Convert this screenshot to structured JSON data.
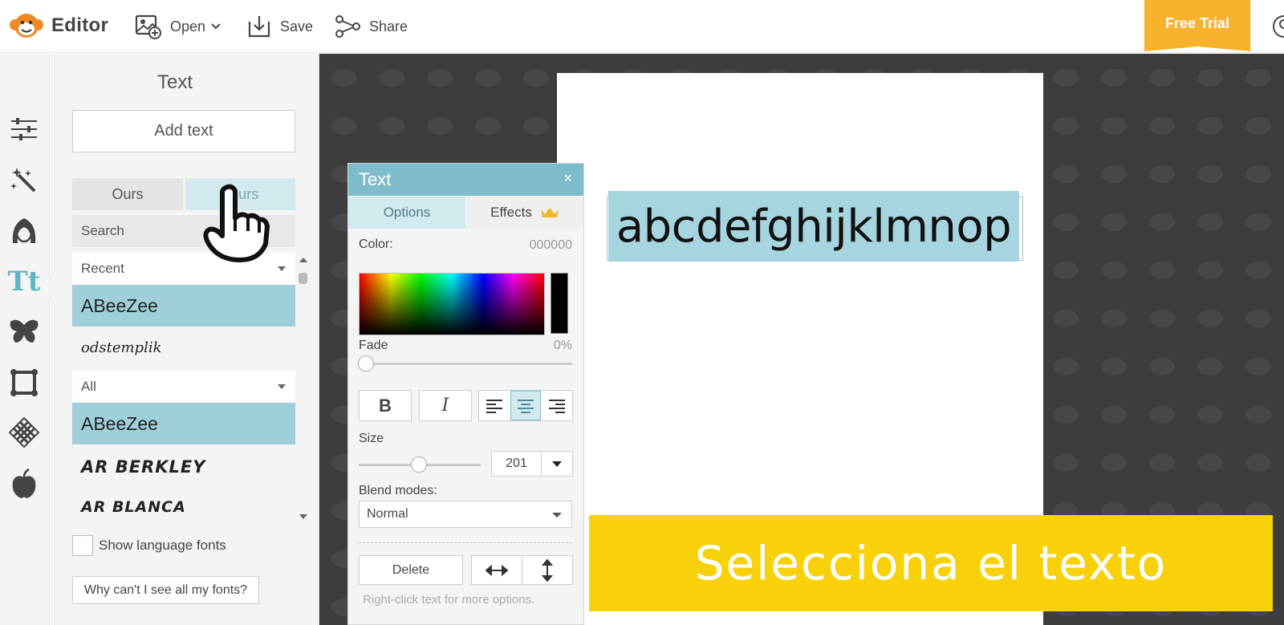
{
  "app": {
    "title": "Editor"
  },
  "toolbar": {
    "open_label": "Open",
    "save_label": "Save",
    "share_label": "Share",
    "free_trial_label": "Free Trial"
  },
  "rail": {
    "items": [
      "adjustments-icon",
      "effects-wand-icon",
      "face-retouch-icon",
      "text-icon",
      "graphics-butterfly-icon",
      "frames-icon",
      "textures-icon",
      "themes-apple-icon"
    ],
    "active": "text-icon",
    "text_glyph": "Tt"
  },
  "panel": {
    "title": "Text",
    "add_text_label": "Add text",
    "tabs": {
      "ours": "Ours",
      "yours": "Yours"
    },
    "search_placeholder": "Search",
    "recent_label": "Recent",
    "recent_fonts": [
      "ABeeZee",
      "odstemplik"
    ],
    "all_label": "All",
    "all_fonts": [
      "ABeeZee",
      "AR BERKLEY",
      "AR BLANCA"
    ],
    "show_language_fonts": "Show language fonts",
    "why_fonts": "Why can't I see all my fonts?"
  },
  "canvas": {
    "text_content": "abcdefghijklmnop"
  },
  "dialog": {
    "title": "Text",
    "close": "×",
    "tabs": {
      "options": "Options",
      "effects": "Effects"
    },
    "color_label": "Color:",
    "color_value": "000000",
    "fade_label": "Fade",
    "fade_value": "0%",
    "fade_fraction": 0,
    "bold": "B",
    "italic": "I",
    "alignment": "center",
    "size_label": "Size",
    "size_value": "201",
    "blend_label": "Blend modes:",
    "blend_value": "Normal",
    "delete_label": "Delete",
    "hint": "Right-click text for more options."
  },
  "banner": {
    "text": "Selecciona el texto"
  },
  "colors": {
    "accent": "#7fbccb",
    "selection": "#a6d4df",
    "brand_orange": "#f08a24",
    "free_trial": "#f7b32b",
    "banner": "#f9d10a",
    "workspace": "#3d3d3d"
  }
}
